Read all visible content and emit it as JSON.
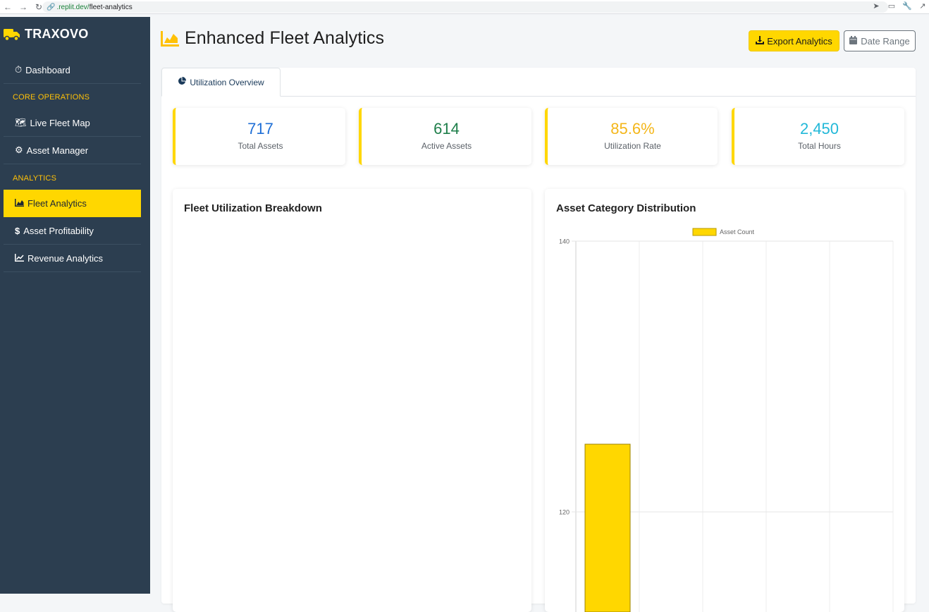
{
  "browser": {
    "url_prefix": ".replit.dev/",
    "url_path": "fleet-analytics"
  },
  "sidebar": {
    "brand": "TRAXOVO",
    "dashboard": "Dashboard",
    "section_core": "CORE OPERATIONS",
    "live_fleet_map": "Live Fleet Map",
    "asset_manager": "Asset Manager",
    "section_analytics": "ANALYTICS",
    "fleet_analytics": "Fleet Analytics",
    "asset_profitability": "Asset Profitability",
    "revenue_analytics": "Revenue Analytics"
  },
  "header": {
    "title": "Enhanced Fleet Analytics",
    "export_label": "Export Analytics",
    "date_range_label": "Date Range"
  },
  "tabs": {
    "utilization_overview": "Utilization Overview"
  },
  "stats": [
    {
      "value": "717",
      "label": "Total Assets",
      "color": "#1f6fd6"
    },
    {
      "value": "614",
      "label": "Active Assets",
      "color": "#1e7e4a"
    },
    {
      "value": "85.6%",
      "label": "Utilization Rate",
      "color": "#f4b619"
    },
    {
      "value": "2,450",
      "label": "Total Hours",
      "color": "#22b8d8"
    }
  ],
  "cards": {
    "utilization_title": "Fleet Utilization Breakdown",
    "category_title": "Asset Category Distribution"
  },
  "colors": {
    "accent": "#ffd700",
    "sidebar_bg": "#2c3e50"
  },
  "chart_data": {
    "type": "bar",
    "title": "",
    "legend": [
      "Asset Count"
    ],
    "legend_position": "top",
    "yticks": [
      120,
      140
    ],
    "ylim": [
      109,
      140
    ],
    "grid": true,
    "categories": [
      "",
      "",
      "",
      "",
      ""
    ],
    "series": [
      {
        "name": "Asset Count",
        "values": [
          125,
          null,
          null,
          null,
          null
        ],
        "color": "#ffd700"
      }
    ]
  }
}
